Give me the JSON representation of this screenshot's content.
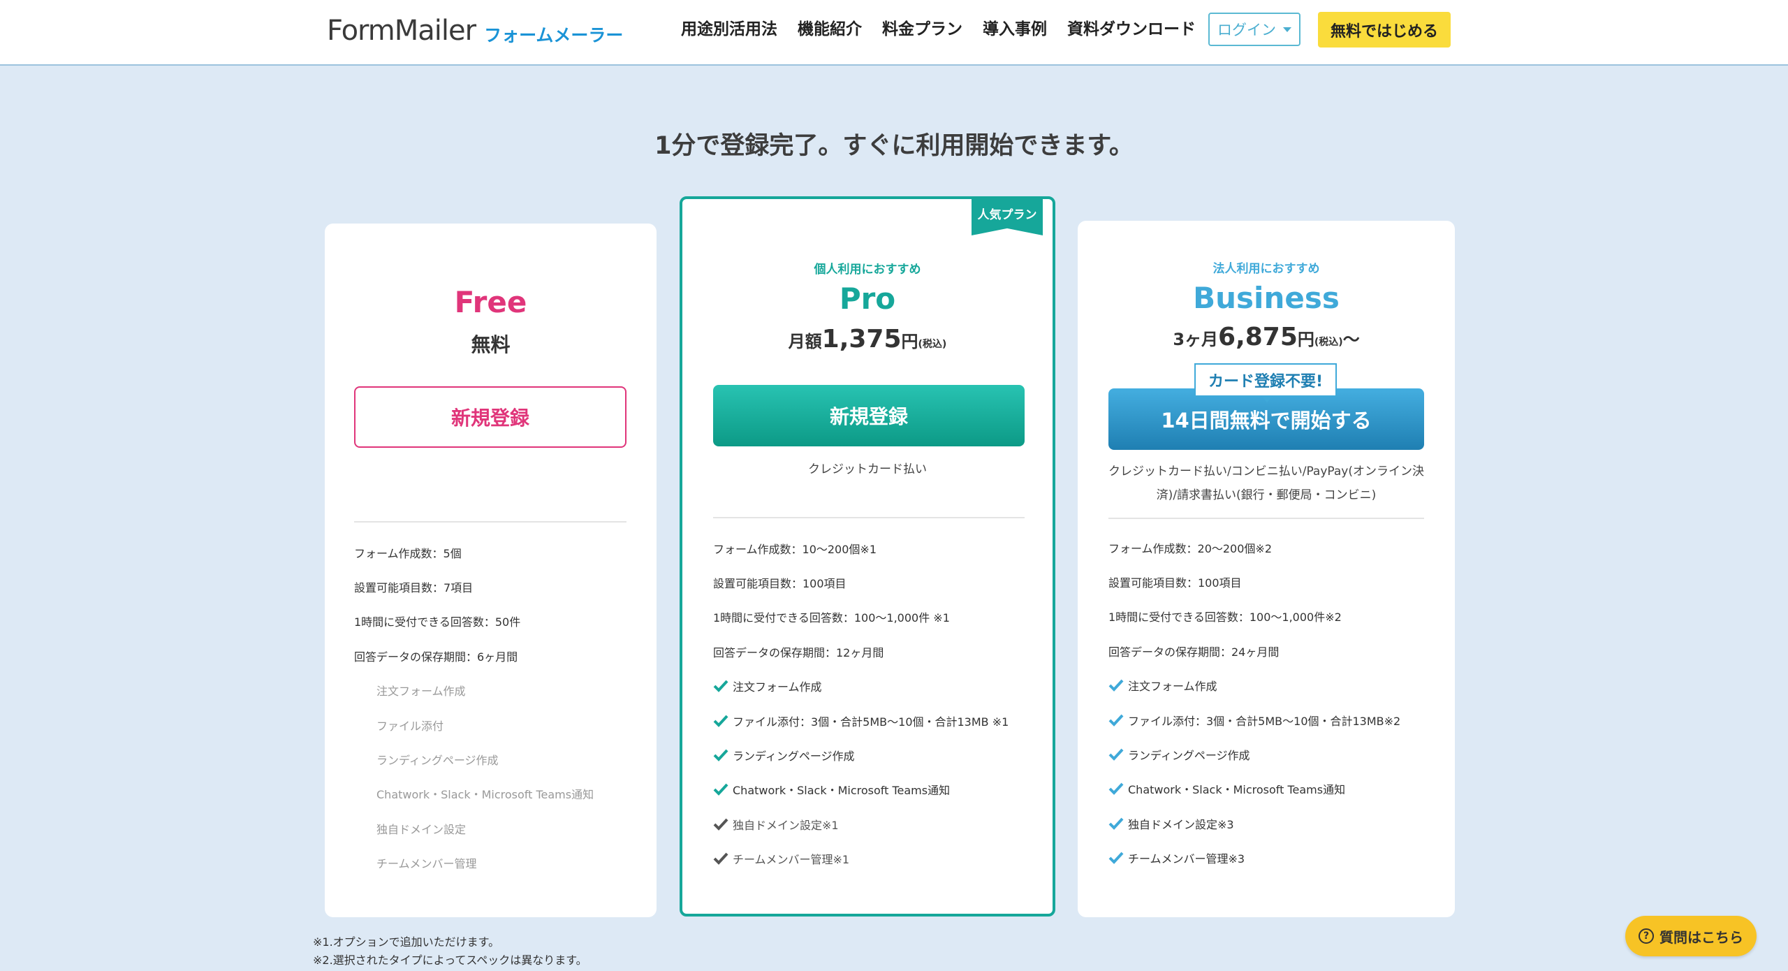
{
  "header": {
    "logo_en": "FormMailer",
    "logo_ja": "フォームメーラー",
    "nav": [
      "用途別活用法",
      "機能紹介",
      "料金プラン",
      "導入事例",
      "資料ダウンロード"
    ],
    "login_label": "ログイン",
    "start_label": "無料ではじめる"
  },
  "hero": {
    "title": "1分で登録完了。すぐに利用開始できます。"
  },
  "colors": {
    "free": "#e0357a",
    "pro": "#16a79a",
    "business": "#3fa9d9",
    "cta_yellow": "#fadc3c"
  },
  "plans": {
    "free": {
      "name": "Free",
      "price_label": "無料",
      "button": "新規登録",
      "features": [
        {
          "text": "フォーム作成数：5個",
          "state": "spec"
        },
        {
          "text": "設置可能項目数：7項目",
          "state": "spec"
        },
        {
          "text": "1時間に受付できる回答数：50件",
          "state": "spec"
        },
        {
          "text": "回答データの保存期間：6ヶ月間",
          "state": "spec"
        },
        {
          "text": "注文フォーム作成",
          "state": "off"
        },
        {
          "text": "ファイル添付",
          "state": "off"
        },
        {
          "text": "ランディングページ作成",
          "state": "off"
        },
        {
          "text": "Chatwork・Slack・Microsoft Teams通知",
          "state": "off"
        },
        {
          "text": "独自ドメイン設定",
          "state": "off"
        },
        {
          "text": "チームメンバー管理",
          "state": "off"
        }
      ]
    },
    "pro": {
      "ribbon": "人気プラン",
      "sub_label": "個人利用におすすめ",
      "name": "Pro",
      "price_prefix": "月額",
      "price_value": "1,375",
      "price_unit": "円",
      "price_tax": "(税込)",
      "button": "新規登録",
      "payment_note": "クレジットカード払い",
      "features": [
        {
          "text": "フォーム作成数：10〜200個※1",
          "state": "spec"
        },
        {
          "text": "設置可能項目数：100項目",
          "state": "spec"
        },
        {
          "text": "1時間に受付できる回答数：100〜1,000件 ※1",
          "state": "spec"
        },
        {
          "text": "回答データの保存期間：12ヶ月間",
          "state": "spec"
        },
        {
          "text": "注文フォーム作成",
          "state": "check"
        },
        {
          "text": "ファイル添付：3個・合計5MB〜10個・合計13MB ※1",
          "state": "check"
        },
        {
          "text": "ランディングページ作成",
          "state": "check"
        },
        {
          "text": "Chatwork・Slack・Microsoft Teams通知",
          "state": "check"
        },
        {
          "text": "独自ドメイン設定※1",
          "state": "check-grey"
        },
        {
          "text": "チームメンバー管理※1",
          "state": "check-grey"
        }
      ]
    },
    "business": {
      "sub_label": "法人利用におすすめ",
      "name": "Business",
      "price_prefix": "3ヶ月",
      "price_value": "6,875",
      "price_unit": "円",
      "price_tax": "(税込)",
      "price_suffix": "〜",
      "badge": "カード登録不要!",
      "button": "14日間無料で開始する",
      "payment_note_1": "クレジットカード払い/コンビニ払い/PayPay(オンライン決",
      "payment_note_2": "済)/請求書払い(銀行・郵便局・コンビニ)",
      "features": [
        {
          "text": "フォーム作成数：20〜200個※2",
          "state": "spec"
        },
        {
          "text": "設置可能項目数：100項目",
          "state": "spec"
        },
        {
          "text": "1時間に受付できる回答数：100〜1,000件※2",
          "state": "spec"
        },
        {
          "text": "回答データの保存期間：24ヶ月間",
          "state": "spec"
        },
        {
          "text": "注文フォーム作成",
          "state": "check"
        },
        {
          "text": "ファイル添付：3個・合計5MB〜10個・合計13MB※2",
          "state": "check"
        },
        {
          "text": "ランディングページ作成",
          "state": "check"
        },
        {
          "text": "Chatwork・Slack・Microsoft Teams通知",
          "state": "check"
        },
        {
          "text": "独自ドメイン設定※3",
          "state": "check"
        },
        {
          "text": "チームメンバー管理※3",
          "state": "check"
        }
      ]
    }
  },
  "footnotes": [
    "※1.オプションで追加いただけます。",
    "※2.選択されたタイプによってスペックは異なります。"
  ],
  "help": {
    "label": "質問はこちら",
    "icon": "question-icon"
  }
}
